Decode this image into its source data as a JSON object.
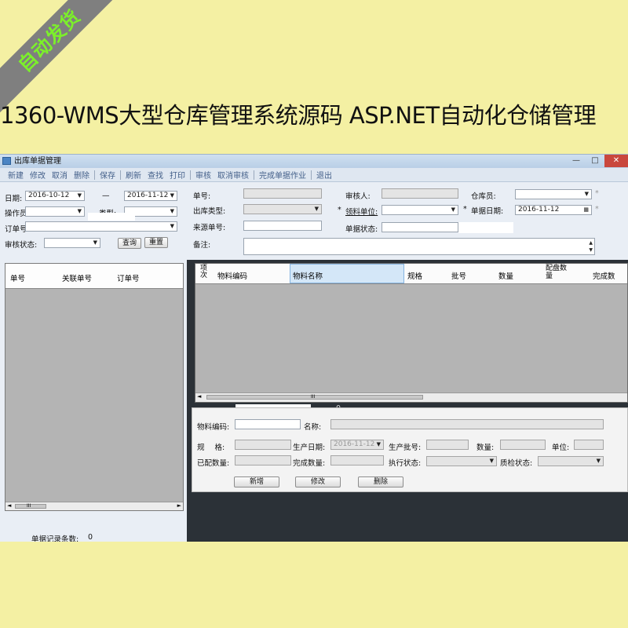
{
  "ribbon": "自动发货",
  "headline": "1360-WMS大型仓库管理系统源码 ASP.NET自动化仓储管理",
  "window": {
    "title": "出库单据管理",
    "controls": [
      "—",
      "□",
      "✕"
    ]
  },
  "toolbar": {
    "items": [
      "新建",
      "修改",
      "取消",
      "删除",
      "保存",
      "刷新",
      "查找",
      "打印",
      "审核",
      "取消审核",
      "完成单据作业",
      "退出"
    ]
  },
  "filter": {
    "date_label": "日期:",
    "date_from": "2016-10-12",
    "date_sep": "—",
    "date_to": "2016-11-12",
    "operator_label": "操作员",
    "operator_value": "",
    "type_label": "类型:",
    "type_value": "",
    "order_label": "订单号",
    "order_value": "",
    "audit_label": "审核状态:",
    "audit_value": "",
    "query_button": "查询",
    "reset_button": "重置"
  },
  "left_grid": {
    "columns": [
      "单号",
      "关联单号",
      "订单号"
    ],
    "footer_label": "单据记录条数:",
    "footer_count": "0"
  },
  "form": {
    "doc_no_label": "单号:",
    "reviewer_label": "审核人:",
    "keeper_label": "仓库员:",
    "out_type_label": "出库类型:",
    "receiver_label": "领料单位:",
    "doc_date_label": "单据日期:",
    "doc_date_value": "2016-11-12",
    "source_label": "来源单号:",
    "status_label": "单据状态:",
    "remark_label": "备注:",
    "required_mark": "*"
  },
  "right_grid": {
    "columns": [
      "项次",
      "物料编码",
      "物料名称",
      "规格",
      "批号",
      "数量",
      "配盘数量",
      "完成数"
    ],
    "footer_count": "0"
  },
  "detail": {
    "material_code_label": "物料编码:",
    "name_label": "名称:",
    "spec_label": "规 格:",
    "prod_date_label": "生产日期:",
    "prod_date_value": "2016-11-12",
    "prod_batch_label": "生产批号:",
    "qty_label": "数量:",
    "unit_label": "单位:",
    "allocated_label": "已配数量:",
    "done_label": "完成数量:",
    "exec_status_label": "执行状态:",
    "qc_status_label": "质检状态:",
    "add_button": "新增",
    "edit_button": "修改",
    "delete_button": "删除"
  },
  "scroll_grip": "III"
}
